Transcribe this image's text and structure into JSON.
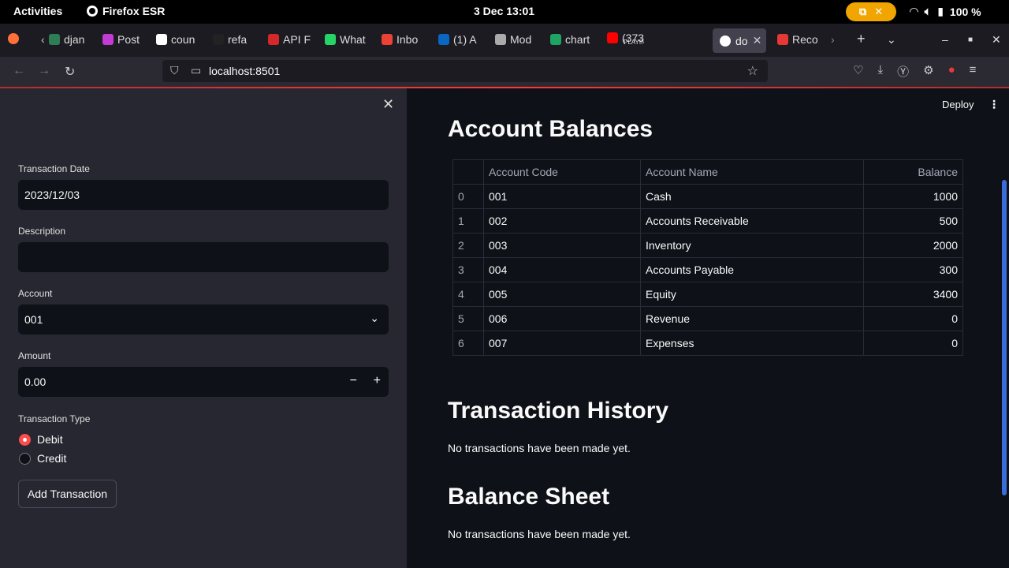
{
  "system_bar": {
    "activities": "Activities",
    "app_name": "Firefox ESR",
    "clock": "3 Dec  13:01",
    "battery": "100 %"
  },
  "browser": {
    "tabs": [
      {
        "label": "djan",
        "icon": "django-icon",
        "color": "#2f7d54"
      },
      {
        "label": "Post",
        "icon": "postman-icon",
        "color": "#c23bd4"
      },
      {
        "label": "coun",
        "icon": "github-icon",
        "color": "#ffffff"
      },
      {
        "label": "refa",
        "icon": "chatgpt-icon",
        "color": "#222222"
      },
      {
        "label": "API F",
        "icon": "api-icon",
        "color": "#d62828"
      },
      {
        "label": "What",
        "icon": "whatsapp-icon",
        "color": "#25d366"
      },
      {
        "label": "Inbo",
        "icon": "gmail-icon",
        "color": "#ea4335"
      },
      {
        "label": "(1) A",
        "icon": "linkedin-icon",
        "color": "#0a66c2"
      },
      {
        "label": "Mod",
        "icon": "notion-icon",
        "color": "#aaaaaa"
      },
      {
        "label": "chart",
        "icon": "sheets-icon",
        "color": "#1fa463"
      },
      {
        "label": "(373",
        "sublabel": "PLAYIN",
        "icon": "youtube-icon",
        "color": "#ff0000"
      },
      {
        "label": "do",
        "icon": "streamlit-icon",
        "color": "#ffffff",
        "active": true
      },
      {
        "label": "Reco",
        "icon": "record-icon",
        "color": "#e53935"
      }
    ],
    "url": "localhost:8501"
  },
  "sidebar": {
    "date_label": "Transaction Date",
    "date_value": "2023/12/03",
    "description_label": "Description",
    "description_value": "",
    "account_label": "Account",
    "account_value": "001",
    "amount_label": "Amount",
    "amount_value": "0.00",
    "type_label": "Transaction Type",
    "type_options": [
      "Debit",
      "Credit"
    ],
    "type_selected": "Debit",
    "add_button": "Add Transaction"
  },
  "main": {
    "deploy_label": "Deploy",
    "balances_title": "Account Balances",
    "table_headers": [
      "",
      "Account Code",
      "Account Name",
      "Balance"
    ],
    "table_rows": [
      [
        "0",
        "001",
        "Cash",
        "1000"
      ],
      [
        "1",
        "002",
        "Accounts Receivable",
        "500"
      ],
      [
        "2",
        "003",
        "Inventory",
        "2000"
      ],
      [
        "3",
        "004",
        "Accounts Payable",
        "300"
      ],
      [
        "4",
        "005",
        "Equity",
        "3400"
      ],
      [
        "5",
        "006",
        "Revenue",
        "0"
      ],
      [
        "6",
        "007",
        "Expenses",
        "0"
      ]
    ],
    "history_title": "Transaction History",
    "history_empty": "No transactions have been made yet.",
    "balance_sheet_title": "Balance Sheet",
    "balance_sheet_empty": "No transactions have been made yet."
  }
}
